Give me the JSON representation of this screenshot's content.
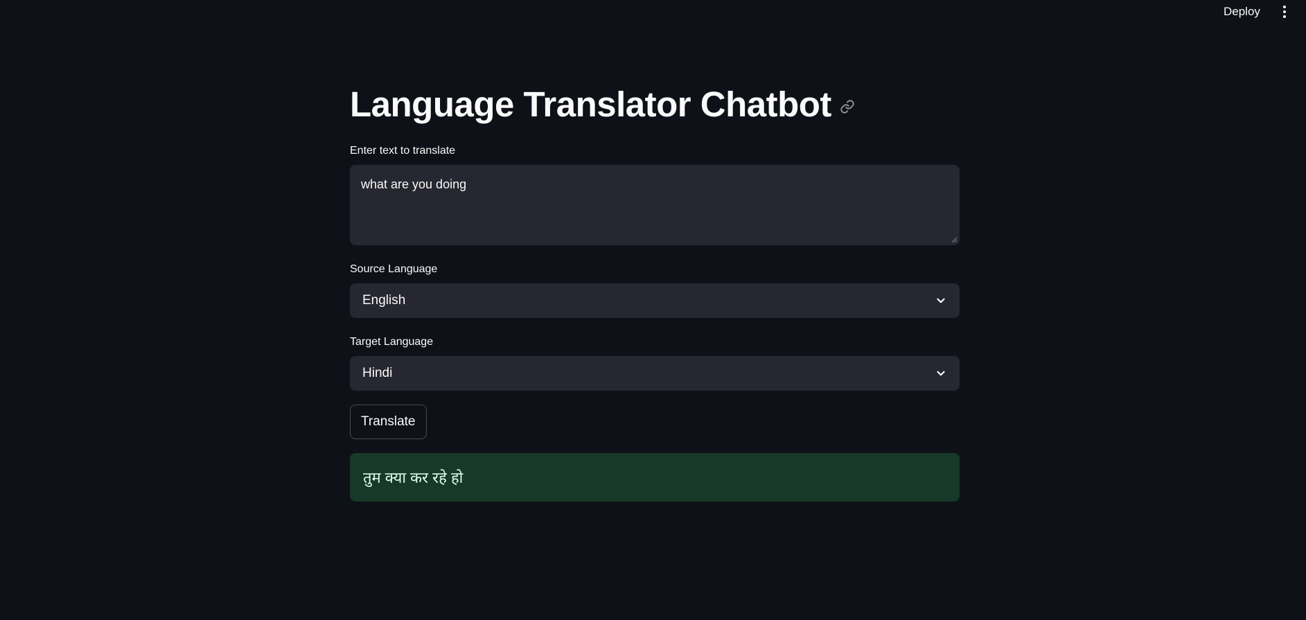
{
  "header": {
    "deploy_label": "Deploy",
    "menu_icon": "kebab-vertical-icon"
  },
  "main": {
    "title": "Language Translator Chatbot",
    "title_anchor_icon": "link-icon",
    "text_input": {
      "label": "Enter text to translate",
      "value": "what are you doing"
    },
    "source_language": {
      "label": "Source Language",
      "selected": "English"
    },
    "target_language": {
      "label": "Target Language",
      "selected": "Hindi"
    },
    "translate_button_label": "Translate",
    "result_text": "तुम क्या कर रहे हो"
  },
  "colors": {
    "background": "#0e1117",
    "input_background": "#262730",
    "success_background": "#173928",
    "success_text": "#dffde9",
    "text": "#fafafa"
  }
}
